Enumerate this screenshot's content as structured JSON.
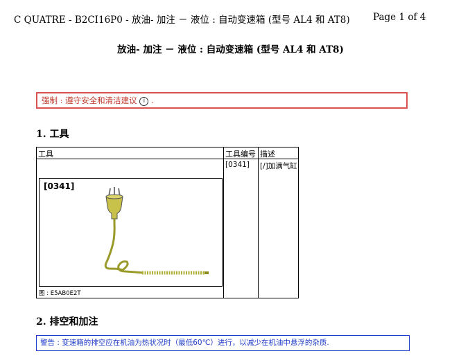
{
  "header": {
    "title_line": "C QUATRE - B2CI16P0 - 放油- 加注 － 液位 : 自动变速箱 (型号 AL4 和 AT8)",
    "page": "Page 1 of 4"
  },
  "doc_title": "放油- 加注 － 液位 : 自动变速箱 (型号 AL4 和 AT8)",
  "mandatory": {
    "text": "强制 : 遵守安全和清洁建议",
    "icon": "info-circle-icon",
    "suffix": ".",
    "border_color": "#d9534f"
  },
  "section1": {
    "heading": "1. 工具"
  },
  "tools_table": {
    "headers": [
      "工具",
      "工具编号",
      "描述"
    ],
    "rows": [
      {
        "tool_no": "[0341]",
        "description": "[/]加满气缸"
      }
    ],
    "figure": {
      "ref": "[0341]",
      "caption": "图 : E5AB0E2T"
    }
  },
  "section2": {
    "heading": "2. 排空和加注"
  },
  "warning": {
    "text": "警告 : 变速箱的排空应在机油为热状况时（最低60℃）进行，以减少在机油中悬浮的杂质.",
    "border_color": "#1f3cc8"
  }
}
